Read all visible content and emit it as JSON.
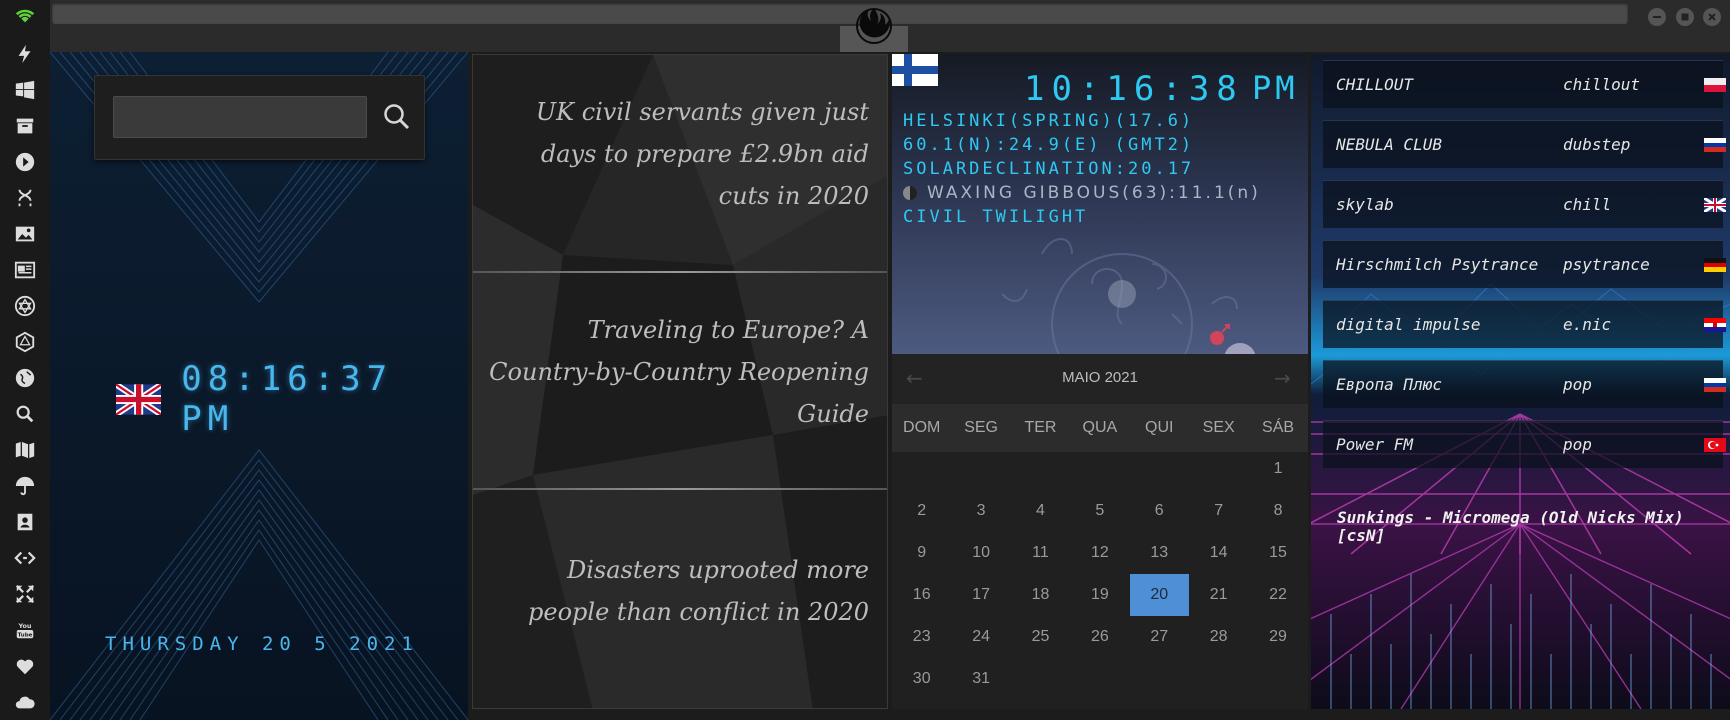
{
  "window": {
    "minimize_icon": "minus-icon",
    "maximize_icon": "square-icon",
    "close_icon": "x-icon"
  },
  "rail": {
    "icons": [
      "wifi-icon",
      "lightning-icon",
      "windows-icon",
      "archive-icon",
      "play-icon",
      "dna-icon",
      "image-icon",
      "newspaper-icon",
      "star-of-david-icon",
      "hexagon-icon",
      "globe-icon",
      "search-icon",
      "map-icon",
      "umbrella-icon",
      "contacts-icon",
      "code-icon",
      "expand-icon",
      "youtube-icon",
      "heart-icon",
      "cloud-icon"
    ]
  },
  "search": {
    "value": "",
    "placeholder": ""
  },
  "clock_left": {
    "time": "08:16:37 PM",
    "date": "THURSDAY 20 5 2021"
  },
  "news": [
    {
      "headline": "UK civil servants given just days to prepare £2.9bn aid cuts in 2020"
    },
    {
      "headline": "Traveling to Europe? A Country-by-Country Reopening Guide"
    },
    {
      "headline": "Disasters uprooted more people than conflict in 2020"
    }
  ],
  "weather": {
    "time": "10:16:38",
    "ampm": "PM",
    "line1": "HELSINKI(SPRING)(17.6)",
    "line2": "60.1(N):24.9(E) (GMT2)",
    "line3": "SOLARDECLINATION:20.17",
    "moon": "WAXING GIBBOUS(63):11.1(n)",
    "twilight": "CIVIL TWILIGHT"
  },
  "calendar": {
    "title": "MAIO 2021",
    "prev": "←",
    "next": "→",
    "weekdays": [
      "DOM",
      "SEG",
      "TER",
      "QUA",
      "QUI",
      "SEX",
      "SÁB"
    ],
    "weeks": [
      [
        "",
        "",
        "",
        "",
        "",
        "",
        "1"
      ],
      [
        "2",
        "3",
        "4",
        "5",
        "6",
        "7",
        "8"
      ],
      [
        "9",
        "10",
        "11",
        "12",
        "13",
        "14",
        "15"
      ],
      [
        "16",
        "17",
        "18",
        "19",
        "20",
        "21",
        "22"
      ],
      [
        "23",
        "24",
        "25",
        "26",
        "27",
        "28",
        "29"
      ],
      [
        "30",
        "31",
        "",
        "",
        "",
        "",
        ""
      ]
    ],
    "today": "20"
  },
  "radio": {
    "stations": [
      {
        "name": "CHILLOUT",
        "genre": "chillout",
        "flag": "poland"
      },
      {
        "name": "NEBULA CLUB",
        "genre": "dubstep",
        "flag": "russia"
      },
      {
        "name": "skylab",
        "genre": "chill",
        "flag": "uk"
      },
      {
        "name": "Hirschmilch Psytrance",
        "genre": "psytrance",
        "flag": "germany"
      },
      {
        "name": "digital impulse",
        "genre": "e.nic",
        "flag": "croatia"
      },
      {
        "name": "Европа Плюс",
        "genre": "pop",
        "flag": "russia"
      },
      {
        "name": "Power FM",
        "genre": "pop",
        "flag": "turkey"
      }
    ],
    "now_playing": "Sunkings - Micromega (Old Nicks Mix) [csN]"
  },
  "colors": {
    "digital": "#2ec9f2",
    "clock_left": "#49b7ee",
    "today": "#4f8fd6"
  }
}
